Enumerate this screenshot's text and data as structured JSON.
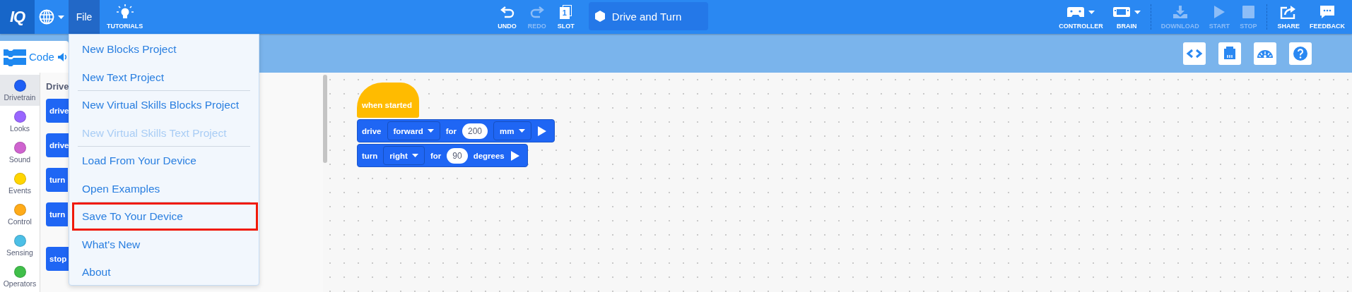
{
  "top_bar": {
    "logo": "IQ",
    "file_button": {
      "label": "File",
      "selected": true
    },
    "tutorials": {
      "label": "TUTORIALS"
    },
    "edit_tools": [
      {
        "kind": "undo",
        "label": "UNDO",
        "disabled": false
      },
      {
        "kind": "redo",
        "label": "REDO",
        "disabled": true
      },
      {
        "kind": "slot",
        "label": "SLOT",
        "slot_number": "1",
        "disabled": false
      }
    ],
    "project_name": "Drive and Turn",
    "device_tools": [
      {
        "kind": "controller",
        "label": "CONTROLLER",
        "disabled": false
      },
      {
        "kind": "brain",
        "label": "BRAIN",
        "disabled": false
      },
      {
        "kind": "download",
        "label": "DOWNLOAD",
        "disabled": true
      },
      {
        "kind": "start",
        "label": "START",
        "disabled": true
      },
      {
        "kind": "stop",
        "label": "STOP",
        "disabled": true
      },
      {
        "kind": "share",
        "label": "SHARE",
        "disabled": false
      },
      {
        "kind": "feedback",
        "label": "FEEDBACK",
        "disabled": false
      }
    ]
  },
  "code_tab": {
    "label": "Code"
  },
  "file_menu": {
    "items": [
      {
        "label": "New Blocks Project",
        "disabled": false,
        "highlighted": false,
        "separator_after": false
      },
      {
        "label": "New Text Project",
        "disabled": false,
        "highlighted": false,
        "separator_after": true
      },
      {
        "label": "New Virtual Skills Blocks Project",
        "disabled": false,
        "highlighted": false,
        "separator_after": false
      },
      {
        "label": "New Virtual Skills Text Project",
        "disabled": true,
        "highlighted": false,
        "separator_after": true
      },
      {
        "label": "Load From Your Device",
        "disabled": false,
        "highlighted": false,
        "separator_after": false
      },
      {
        "label": "Open Examples",
        "disabled": false,
        "highlighted": false,
        "separator_after": true
      },
      {
        "label": "Save To Your Device",
        "disabled": false,
        "highlighted": true,
        "separator_after": false
      },
      {
        "label": "What's New",
        "disabled": false,
        "highlighted": false,
        "separator_after": false
      },
      {
        "label": "About",
        "disabled": false,
        "highlighted": false,
        "separator_after": false
      }
    ]
  },
  "categories": [
    {
      "label": "Drivetrain",
      "color": "#1e5ff5",
      "selected": true
    },
    {
      "label": "Looks",
      "color": "#9966ff",
      "selected": false
    },
    {
      "label": "Sound",
      "color": "#cf63cf",
      "selected": false
    },
    {
      "label": "Events",
      "color": "#ffd500",
      "selected": false
    },
    {
      "label": "Control",
      "color": "#ffab19",
      "selected": false
    },
    {
      "label": "Sensing",
      "color": "#4cbfe6",
      "selected": false
    },
    {
      "label": "Operators",
      "color": "#40bf4a",
      "selected": false
    }
  ],
  "palette": {
    "title": "Drive",
    "blocks": [
      {
        "label": "drive"
      },
      {
        "label": "drive"
      },
      {
        "label": "turn"
      },
      {
        "label": "turn"
      },
      {
        "label": "stop"
      }
    ]
  },
  "canvas": {
    "blocks": [
      {
        "kind": "hat",
        "parts": [
          {
            "kind": "text",
            "text": "when started"
          }
        ]
      },
      {
        "kind": "stack",
        "parts": [
          {
            "kind": "text",
            "text": "drive"
          },
          {
            "kind": "dropdown",
            "text": "forward"
          },
          {
            "kind": "text",
            "text": "for"
          },
          {
            "kind": "number",
            "text": "200"
          },
          {
            "kind": "dropdown",
            "text": "mm"
          },
          {
            "kind": "run"
          }
        ]
      },
      {
        "kind": "stack",
        "parts": [
          {
            "kind": "text",
            "text": "turn"
          },
          {
            "kind": "dropdown",
            "text": "right"
          },
          {
            "kind": "text",
            "text": "for"
          },
          {
            "kind": "number",
            "text": "90"
          },
          {
            "kind": "text",
            "text": "degrees"
          },
          {
            "kind": "run"
          }
        ]
      }
    ]
  }
}
